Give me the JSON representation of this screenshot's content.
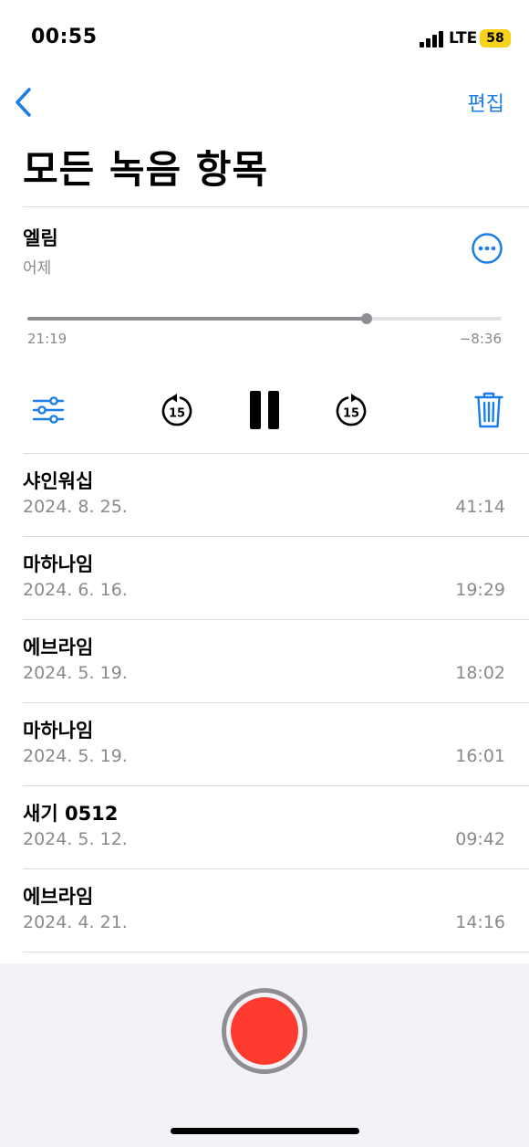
{
  "status_bar": {
    "time": "00:55",
    "network": "LTE",
    "battery": "58"
  },
  "nav": {
    "edit_label": "편집"
  },
  "page_title": "모든 녹음 항목",
  "now_playing": {
    "title": "엘림",
    "date": "어제",
    "elapsed": "21:19",
    "remaining": "−8:36",
    "progress": 0.716
  },
  "controls": {
    "skip_back_label": "15",
    "skip_forward_label": "15"
  },
  "recordings": [
    {
      "title": "샤인워십",
      "date": "2024. 8. 25.",
      "duration": "41:14"
    },
    {
      "title": "마하나임",
      "date": "2024. 6. 16.",
      "duration": "19:29"
    },
    {
      "title": "에브라임",
      "date": "2024. 5. 19.",
      "duration": "18:02"
    },
    {
      "title": "마하나임",
      "date": "2024. 5. 19.",
      "duration": "16:01"
    },
    {
      "title": "새기 0512",
      "date": "2024. 5. 12.",
      "duration": "09:42"
    },
    {
      "title": "에브라임",
      "date": "2024. 4. 21.",
      "duration": "14:16"
    }
  ],
  "colors": {
    "accent": "#1a7ee6",
    "record": "#ff3b30",
    "secondary_text": "#8a8a8e"
  },
  "icons": [
    "back-chevron-icon",
    "more-icon",
    "filter-sliders-icon",
    "skip-back-15-icon",
    "pause-icon",
    "skip-forward-15-icon",
    "trash-icon",
    "record-icon"
  ]
}
